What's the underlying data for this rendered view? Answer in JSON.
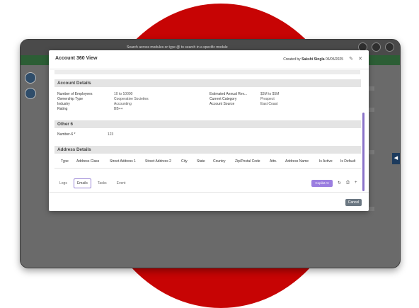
{
  "background_app": {
    "search_placeholder": "Search across modules or type @ to search in a specific module"
  },
  "modal": {
    "title": "Account 360 View",
    "created_by_prefix": "Created by",
    "created_by_name": "Sakshi Singla",
    "created_date": "06/05/2025",
    "sections": {
      "account_details": "Account Details",
      "other": "Other 6",
      "address": "Address Details"
    },
    "account_left_fields": [
      {
        "label": "Number of Employees",
        "value": "10 to 10000"
      },
      {
        "label": "Ownership Type",
        "value": "Cooperative Societies"
      },
      {
        "label": "Industry",
        "value": "Accounting"
      },
      {
        "label": "Rating",
        "value": "BB++"
      }
    ],
    "account_right_fields": [
      {
        "label": "Estimated Annual Rev...",
        "value": "$3M to $5M"
      },
      {
        "label": "Current Category",
        "value": "Prospect"
      },
      {
        "label": "Account Source",
        "value": "East Coast"
      }
    ],
    "other_fields": [
      {
        "label": "Number-6 *",
        "value": "123"
      }
    ],
    "address_columns": [
      "Type",
      "Address Class",
      "Street Address 1",
      "Street Address 2",
      "City",
      "State",
      "Country",
      "Zip/Postal Code",
      "Attn.",
      "Address Name",
      "Is Active",
      "Is Default"
    ],
    "tabs": [
      "Logs",
      "Emails",
      "Tasks",
      "Event"
    ],
    "active_tab": "Emails",
    "copilot_label": "Copilot AI",
    "cancel_label": "Cancel"
  },
  "colors": {
    "accent": "#9b7ee0",
    "backdrop_circle": "#c70404",
    "cancel_button": "#6b7782"
  }
}
